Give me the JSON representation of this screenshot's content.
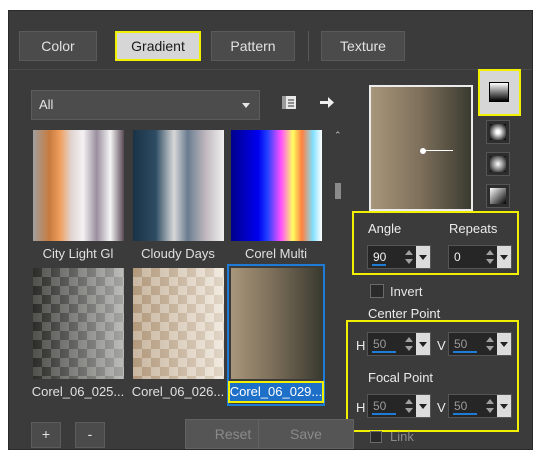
{
  "tabs": [
    {
      "label": "Color",
      "active": false
    },
    {
      "label": "Gradient",
      "active": true
    },
    {
      "label": "Pattern",
      "active": false
    },
    {
      "label": "Texture",
      "active": false
    }
  ],
  "library": {
    "selected": "All"
  },
  "swatches": [
    {
      "label": "City Light Gl",
      "selected": false
    },
    {
      "label": "Cloudy Days",
      "selected": false
    },
    {
      "label": "Corel Multi",
      "selected": false
    },
    {
      "label": "Corel_06_025...",
      "selected": false
    },
    {
      "label": "Corel_06_026...",
      "selected": false
    },
    {
      "label": "Corel_06_029...",
      "selected": true
    }
  ],
  "gradient_styles": [
    "linear",
    "rectangular",
    "sunburst",
    "radial"
  ],
  "angle": {
    "label": "Angle",
    "value": "90"
  },
  "repeats": {
    "label": "Repeats",
    "value": "0"
  },
  "invert": {
    "label": "Invert",
    "checked": false
  },
  "center_point": {
    "label": "Center Point",
    "h_label": "H",
    "h_value": "50",
    "v_label": "V",
    "v_value": "50"
  },
  "focal_point": {
    "label": "Focal Point",
    "h_label": "H",
    "h_value": "50",
    "v_label": "V",
    "v_value": "50"
  },
  "bottom": {
    "add": "+",
    "remove": "-",
    "reset": "Reset",
    "save": "Save",
    "link": "Link"
  },
  "colors": {
    "highlight": "#f0f000",
    "selection": "#1e7bd6",
    "panel": "#3b3b3b"
  }
}
